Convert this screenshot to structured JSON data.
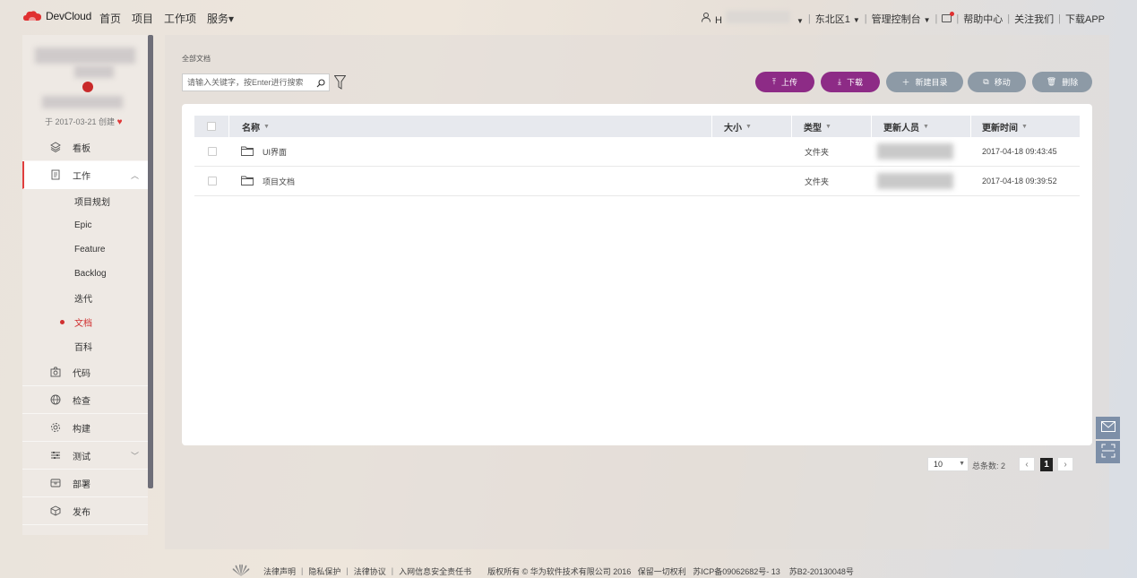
{
  "brand": {
    "name": "DevCloud",
    "accent": "#8d2b86",
    "red": "#e03e3e"
  },
  "topnav": [
    "首页",
    "项目",
    "工作项",
    "服务▾"
  ],
  "topright": {
    "user_initial": "H",
    "region": "东北区1",
    "console": "管理控制台",
    "help": "帮助中心",
    "follow": "关注我们",
    "download_app": "下载APP"
  },
  "sidebar": {
    "created": "于 2017-03-21 创建",
    "items": [
      {
        "label": "看板",
        "icon": "layers-icon"
      },
      {
        "label": "工作",
        "icon": "document-icon",
        "expanded": true
      },
      {
        "label": "代码",
        "icon": "camera-code-icon"
      },
      {
        "label": "检查",
        "icon": "globe-icon"
      },
      {
        "label": "构建",
        "icon": "gear-icon"
      },
      {
        "label": "测试",
        "icon": "sliders-icon"
      },
      {
        "label": "部署",
        "icon": "box-icon"
      },
      {
        "label": "发布",
        "icon": "package-icon"
      }
    ],
    "sub_items": [
      "项目规划",
      "Epic",
      "Feature",
      "Backlog",
      "迭代",
      "文档",
      "百科"
    ],
    "active_sub": "文档"
  },
  "main": {
    "breadcrumb": "全部文档",
    "search_placeholder": "请输入关键字，按Enter进行搜索",
    "buttons": {
      "upload": "上传",
      "download": "下载",
      "new_dir": "新建目录",
      "move": "移动",
      "delete": "删除"
    },
    "table": {
      "headers": [
        "名称",
        "大小",
        "类型",
        "更新人员",
        "更新时间"
      ],
      "rows": [
        {
          "name": "UI界面",
          "size": "",
          "type": "文件夹",
          "updated_by": "",
          "updated_at": "2017-04-18 09:43:45"
        },
        {
          "name": "项目文档",
          "size": "",
          "type": "文件夹",
          "updated_by": "",
          "updated_at": "2017-04-18 09:39:52"
        }
      ]
    },
    "pager": {
      "page_size": "10",
      "total_label": "总条数: 2",
      "current": "1"
    }
  },
  "footer": {
    "links": [
      "法律声明",
      "隐私保护",
      "法律协议",
      "入网信息安全责任书"
    ],
    "copyright": "版权所有 © 华为软件技术有限公司 2016   保留一切权利   苏ICP备09062682号- 13    苏B2-20130048号"
  }
}
